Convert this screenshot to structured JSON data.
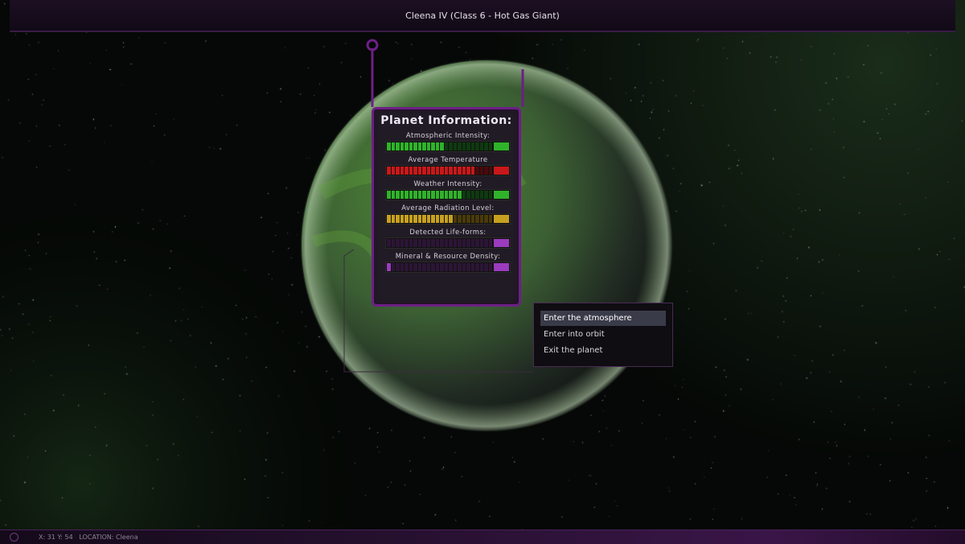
{
  "header": {
    "title": "Cleena IV (Class 6 - Hot Gas Giant)"
  },
  "planet_panel": {
    "title": "Planet Information:",
    "stats": [
      {
        "label": "Atmospheric Intensity:",
        "level": 0.55,
        "color": "#2fb32a",
        "dim": "#0e3a10"
      },
      {
        "label": "Average Temperature",
        "level": 0.85,
        "color": "#c8181a",
        "dim": "#4a0a0c"
      },
      {
        "label": "Weather Intensity:",
        "level": 0.72,
        "color": "#2fb32a",
        "dim": "#0e3a10"
      },
      {
        "label": "Average Radiation Level:",
        "level": 0.62,
        "color": "#c8a020",
        "dim": "#4a3a0a"
      },
      {
        "label": "Detected Life-forms:",
        "level": 0.0,
        "color": "#9b3bbd",
        "dim": "#2c1536"
      },
      {
        "label": "Mineral & Resource Density:",
        "level": 0.05,
        "color": "#9b3bbd",
        "dim": "#2c1536"
      }
    ]
  },
  "menu": {
    "items": [
      {
        "label": "Enter the atmosphere",
        "selected": true
      },
      {
        "label": "Enter into orbit",
        "selected": false
      },
      {
        "label": "Exit the planet",
        "selected": false
      }
    ]
  },
  "status": {
    "coords": "X: 31 Y: 54",
    "location": "LOCATION: Cleena"
  },
  "colors": {
    "accent": "#6e1f86",
    "planet": "#3f7a2a"
  }
}
